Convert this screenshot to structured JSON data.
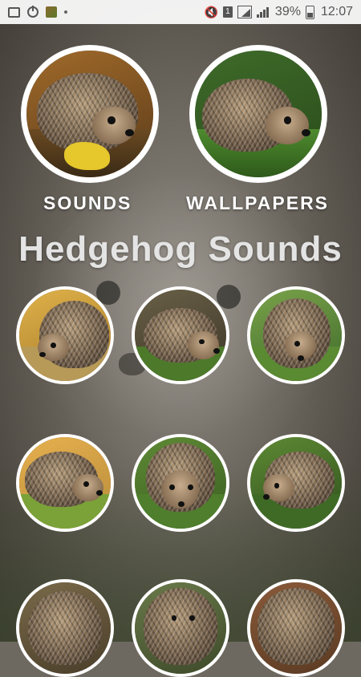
{
  "status_bar": {
    "battery": "39%",
    "time": "12:07",
    "sim_badge": "1",
    "icons": [
      "gallery-icon",
      "power-icon",
      "app-thumbnail-icon",
      "dot-icon",
      "mute-icon",
      "sim-icon",
      "signal-box-icon",
      "signal-bars-icon",
      "battery-icon"
    ]
  },
  "menu": {
    "sounds_label": "SOUNDS",
    "wallpapers_label": "WALLPAPERS"
  },
  "title": "Hedgehog Sounds",
  "grid_items_count_visible": 9,
  "colors": {
    "status_bar_bg": "#f2f2f2",
    "title_text": "#e4e4e4",
    "circle_border": "#ffffff"
  }
}
